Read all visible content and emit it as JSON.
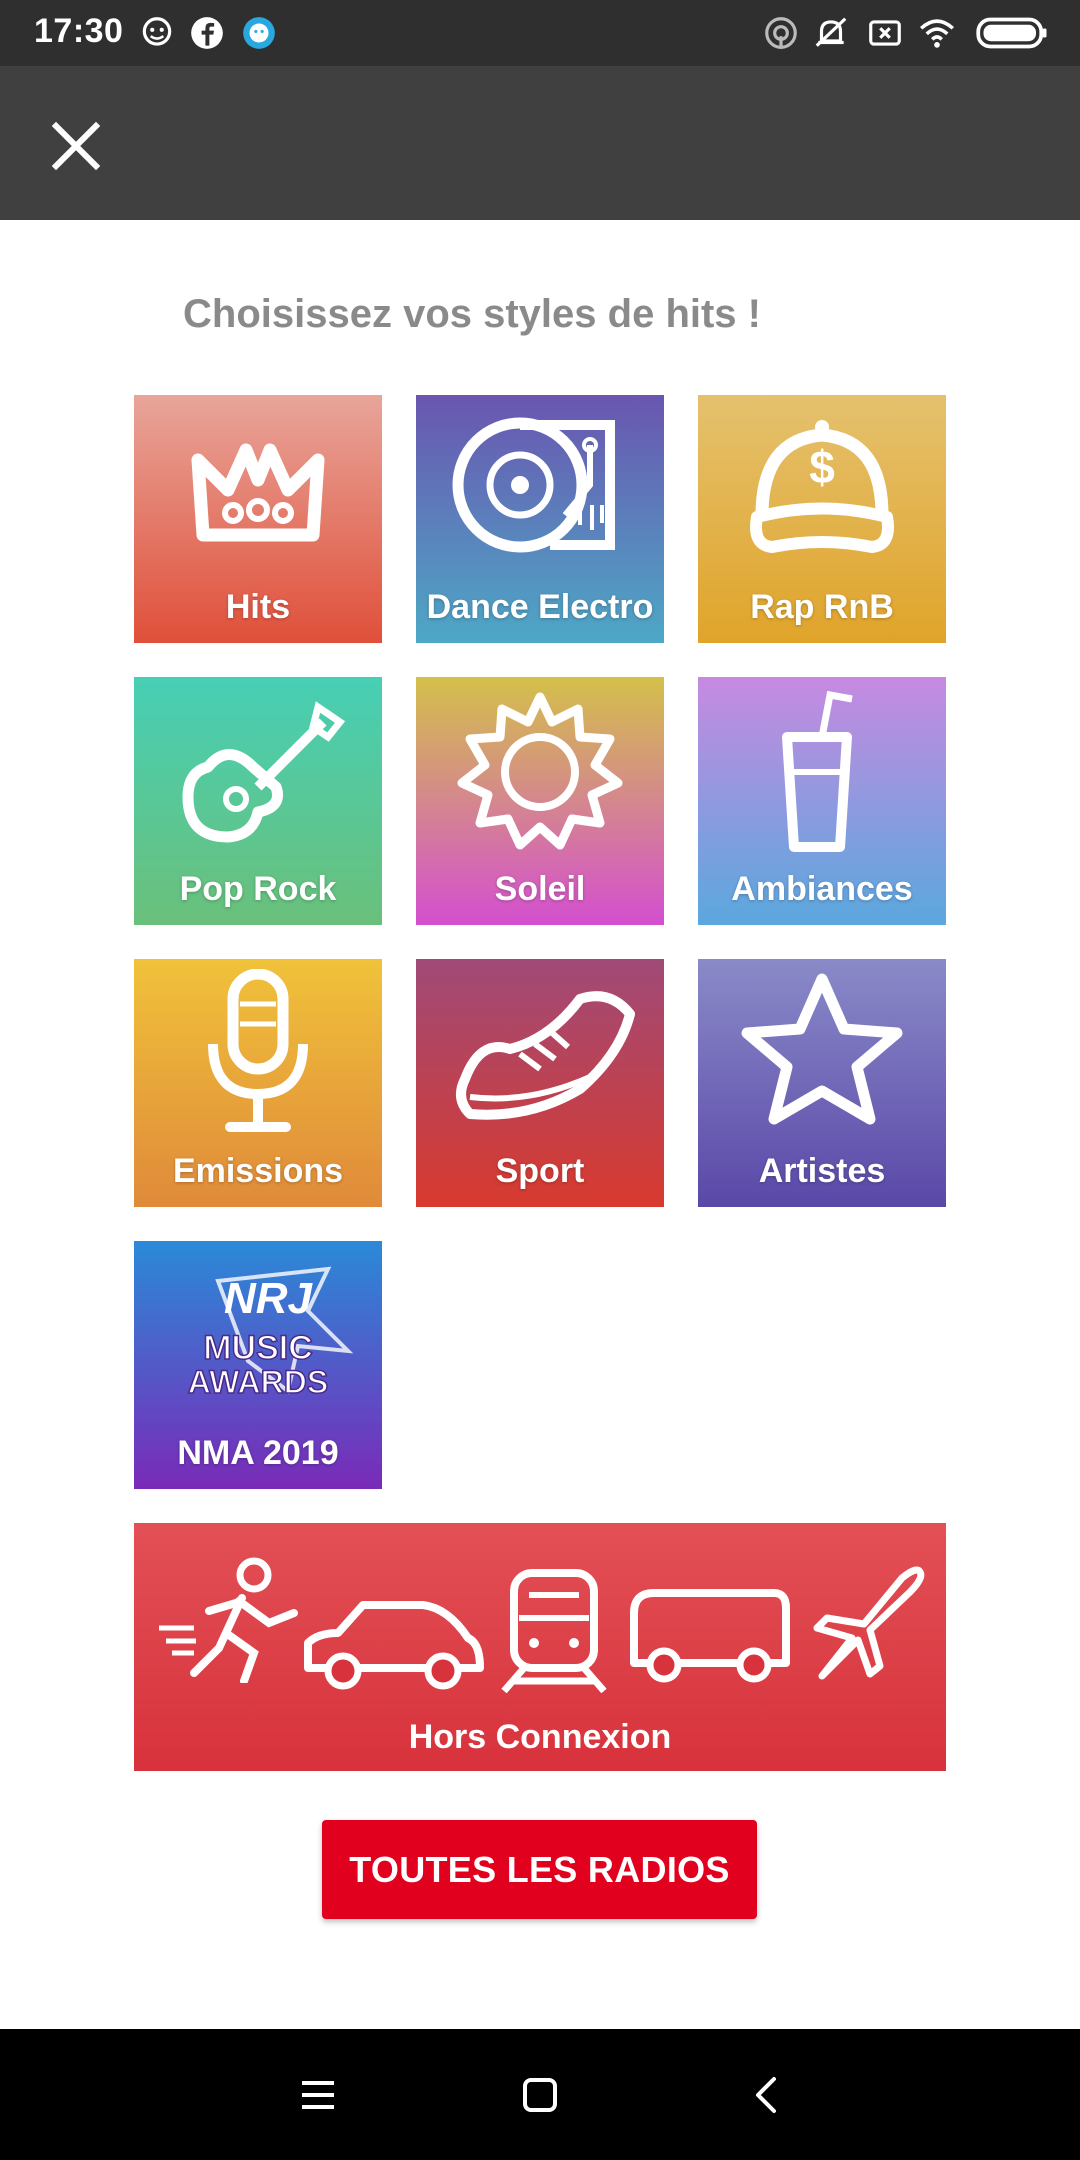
{
  "status_bar": {
    "time": "17:30",
    "left_icons": [
      "waze-icon",
      "facebook-icon",
      "chat-bubble-icon"
    ],
    "right_icons": [
      "hotspot-icon",
      "mute-icon",
      "no-sim-icon",
      "wifi-icon",
      "battery-icon"
    ]
  },
  "header": {
    "close_icon": "close-icon"
  },
  "page": {
    "title": "Choisissez vos styles de hits !"
  },
  "tiles": [
    {
      "label": "Hits",
      "icon": "crown-icon",
      "colors": [
        "#e8a59a",
        "#e0503a"
      ]
    },
    {
      "label": "Dance Electro",
      "icon": "turntable-icon",
      "colors": [
        "#6a55b0",
        "#4da8c6"
      ]
    },
    {
      "label": "Rap RnB",
      "icon": "cap-icon",
      "colors": [
        "#e5c16e",
        "#e0a42a"
      ]
    },
    {
      "label": "Pop Rock",
      "icon": "guitar-icon",
      "colors": [
        "#47cfb5",
        "#6ac07a"
      ]
    },
    {
      "label": "Soleil",
      "icon": "sun-icon",
      "colors": [
        "#d4c04a",
        "#d44fd0"
      ]
    },
    {
      "label": "Ambiances",
      "icon": "drink-icon",
      "colors": [
        "#c68ae0",
        "#5aa8de"
      ]
    },
    {
      "label": "Emissions",
      "icon": "microphone-icon",
      "colors": [
        "#f0c23a",
        "#e08a3a"
      ]
    },
    {
      "label": "Sport",
      "icon": "sneaker-icon",
      "colors": [
        "#a04a78",
        "#d83a2e"
      ]
    },
    {
      "label": "Artistes",
      "icon": "star-icon",
      "colors": [
        "#8a8ac8",
        "#5a48a8"
      ]
    },
    {
      "label": "NMA 2019",
      "icon": "nrj-music-awards-logo",
      "colors": [
        "#2a8ad8",
        "#7a2ab8"
      ]
    }
  ],
  "nrj_logo_text": [
    "NRJ",
    "MUSIC",
    "AWARDS"
  ],
  "offline": {
    "label": "Hors Connexion",
    "icons": [
      "runner-icon",
      "car-icon",
      "train-icon",
      "bus-icon",
      "airplane-icon"
    ]
  },
  "cta": {
    "label": "TOUTES LES RADIOS",
    "color": "#e1001e"
  },
  "nav_bar": {
    "icons": [
      "menu-icon",
      "home-icon",
      "back-icon"
    ]
  }
}
